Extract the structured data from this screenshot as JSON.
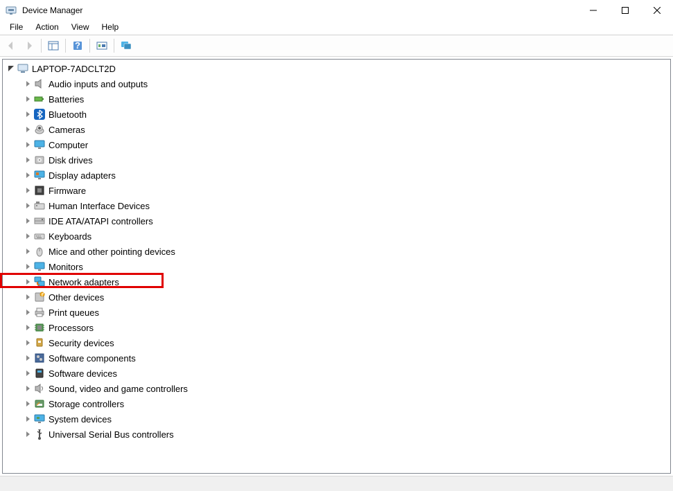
{
  "window": {
    "title": "Device Manager"
  },
  "menu": {
    "file": "File",
    "action": "Action",
    "view": "View",
    "help": "Help"
  },
  "tree": {
    "root": "LAPTOP-7ADCLT2D",
    "categories": [
      {
        "label": "Audio inputs and outputs",
        "icon": "speaker"
      },
      {
        "label": "Batteries",
        "icon": "battery"
      },
      {
        "label": "Bluetooth",
        "icon": "bluetooth"
      },
      {
        "label": "Cameras",
        "icon": "camera"
      },
      {
        "label": "Computer",
        "icon": "monitor"
      },
      {
        "label": "Disk drives",
        "icon": "disk"
      },
      {
        "label": "Display adapters",
        "icon": "display"
      },
      {
        "label": "Firmware",
        "icon": "chipcard"
      },
      {
        "label": "Human Interface Devices",
        "icon": "hid"
      },
      {
        "label": "IDE ATA/ATAPI controllers",
        "icon": "ide"
      },
      {
        "label": "Keyboards",
        "icon": "keyboard"
      },
      {
        "label": "Mice and other pointing devices",
        "icon": "mouse"
      },
      {
        "label": "Monitors",
        "icon": "monitor2"
      },
      {
        "label": "Network adapters",
        "icon": "network",
        "highlighted": true
      },
      {
        "label": "Other devices",
        "icon": "other"
      },
      {
        "label": "Print queues",
        "icon": "printer"
      },
      {
        "label": "Processors",
        "icon": "cpu"
      },
      {
        "label": "Security devices",
        "icon": "security"
      },
      {
        "label": "Software components",
        "icon": "swcomp"
      },
      {
        "label": "Software devices",
        "icon": "swdev"
      },
      {
        "label": "Sound, video and game controllers",
        "icon": "sound"
      },
      {
        "label": "Storage controllers",
        "icon": "storage"
      },
      {
        "label": "System devices",
        "icon": "system"
      },
      {
        "label": "Universal Serial Bus controllers",
        "icon": "usb"
      }
    ]
  }
}
